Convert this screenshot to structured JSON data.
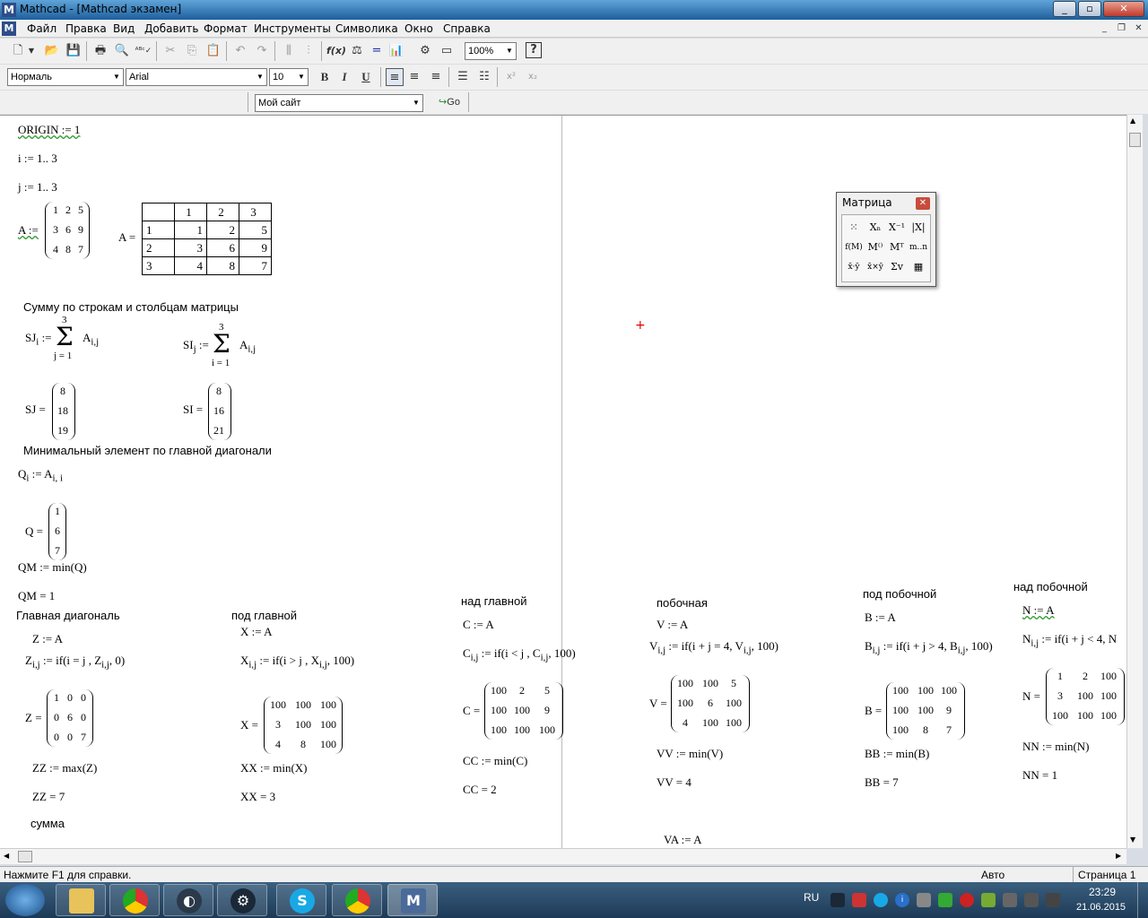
{
  "window": {
    "title": "Mathcad - [Mathcad экзамен]",
    "app_icon": "M"
  },
  "menu": [
    "Файл",
    "Правка",
    "Вид",
    "Добавить",
    "Формат",
    "Инструменты",
    "Символика",
    "Окно",
    "Справка"
  ],
  "toolbar": {
    "zoom": "100%",
    "style": "Нормаль",
    "font": "Arial",
    "size": "10",
    "url": "Мой сайт",
    "go": "Go"
  },
  "palette": {
    "title": "Матрица",
    "items": [
      "⁙",
      "Xₙ",
      "X⁻¹",
      "|X|",
      "f(M)",
      "M⁽⁾",
      "Mᵀ",
      "m..n",
      "x̄·ȳ",
      "x̄×ȳ",
      "Σv",
      "▦"
    ]
  },
  "doc": {
    "origin": "ORIGIN := 1",
    "i_range": "i := 1.. 3",
    "j_range": "j := 1.. 3",
    "A_def": "A :=",
    "A_eq": "A =",
    "A_def_vals": [
      "1",
      "2",
      "5",
      "3",
      "6",
      "9",
      "4",
      "8",
      "7"
    ],
    "A_table": {
      "headers": [
        "",
        "1",
        "2",
        "3"
      ],
      "rows": [
        [
          "1",
          "1",
          "2",
          "5"
        ],
        [
          "2",
          "3",
          "6",
          "9"
        ],
        [
          "3",
          "4",
          "8",
          "7"
        ]
      ]
    },
    "heading_sums": "Сумму по строкам и столбцам матрицы",
    "SJ_lhs": "SJ",
    "SJ_sub": "i",
    "SI_lhs": "SI",
    "SI_sub": "j",
    "assign": ":=",
    "sum_top": "3",
    "sum_bot_j": "j = 1",
    "sum_bot_i": "i = 1",
    "A_ij": "A",
    "ij": "i,j",
    "SJ_eq": "SJ =",
    "SJ_vals": [
      "8",
      "18",
      "19"
    ],
    "SI_eq": "SI =",
    "SI_vals": [
      "8",
      "16",
      "21"
    ],
    "heading_min": "Минимальный элемент по главной диагонали",
    "Q_def": "Q",
    "Q_sub": "i",
    "Q_rhs": ":= A",
    "Q_rhs_sub": "i, i",
    "Q_eq": "Q =",
    "Q_vals": [
      "1",
      "6",
      "7"
    ],
    "QM_def": "QM := min(Q)",
    "QM_eq": "QM = 1",
    "main_diag": "Главная диагональ",
    "Z_def": "Z := A",
    "Z_if": "Z",
    "Z_if_rhs": ":= if(i = j , Z",
    "Z_if_end": ", 0)",
    "Z_eq": "Z =",
    "Z_vals": [
      "1",
      "0",
      "0",
      "0",
      "6",
      "0",
      "0",
      "0",
      "7"
    ],
    "ZZ_def": "ZZ := max(Z)",
    "ZZ_eq": "ZZ = 7",
    "summa": "сумма",
    "under_main": "под главной",
    "X_def": "X := A",
    "X_if": "X",
    "X_if_rhs": ":= if(i > j , X",
    "X_if_end": ", 100)",
    "X_eq": "X =",
    "X_vals": [
      "100",
      "100",
      "100",
      "3",
      "100",
      "100",
      "4",
      "8",
      "100"
    ],
    "XX_def": "XX := min(X)",
    "XX_eq": "XX = 3",
    "above_main": "над главной",
    "C_def": "C := A",
    "C_if": "C",
    "C_if_rhs": ":= if(i < j , C",
    "C_if_end": ", 100)",
    "C_eq": "C =",
    "C_vals": [
      "100",
      "2",
      "5",
      "100",
      "100",
      "9",
      "100",
      "100",
      "100"
    ],
    "CC_def": "CC := min(C)",
    "CC_eq": "CC = 2",
    "secondary": "побочная",
    "V_def": "V := A",
    "V_if": "V",
    "V_if_rhs": ":= if(i + j = 4, V",
    "V_if_end": ", 100)",
    "V_eq": "V =",
    "V_vals": [
      "100",
      "100",
      "5",
      "100",
      "6",
      "100",
      "4",
      "100",
      "100"
    ],
    "VV_def": "VV := min(V)",
    "VV_eq": "VV = 4",
    "VA_def": "VA := A",
    "under_secondary": "под побочной",
    "B_def": "B := A",
    "B_if": "B",
    "B_if_rhs": ":= if(i + j > 4, B",
    "B_if_end": ", 100)",
    "B_eq": "B =",
    "B_vals": [
      "100",
      "100",
      "100",
      "100",
      "100",
      "9",
      "100",
      "8",
      "7"
    ],
    "BB_def": "BB := min(B)",
    "BB_eq": "BB = 7",
    "above_secondary": "над побочной",
    "N_def": "N := A",
    "N_if": "N",
    "N_if_rhs": ":= if(i + j < 4, N",
    "N_eq": "N =",
    "N_vals": [
      "1",
      "2",
      "100",
      "3",
      "100",
      "100",
      "100",
      "100",
      "100"
    ],
    "NN_def": "NN := min(N)",
    "NN_eq": "NN = 1"
  },
  "status": {
    "help": "Нажмите F1 для справки.",
    "mode": "Авто",
    "page": "Страница 1"
  },
  "taskbar": {
    "lang": "RU",
    "time": "23:29",
    "date": "21.06.2015"
  }
}
